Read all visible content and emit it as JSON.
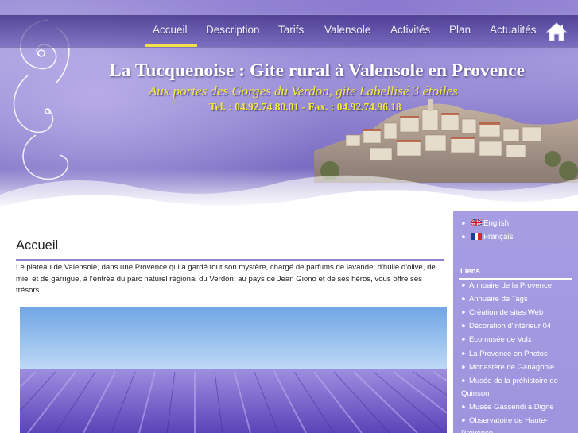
{
  "nav": {
    "items": [
      {
        "label": "Accueil",
        "active": true
      },
      {
        "label": "Description"
      },
      {
        "label": "Tarifs"
      },
      {
        "label": "Valensole"
      },
      {
        "label": "Activités"
      },
      {
        "label": "Plan"
      },
      {
        "label": "Actualités"
      }
    ],
    "home_icon": "home-icon",
    "accent_color": "#f2e04b"
  },
  "header": {
    "title": "La Tucquenoise : Gite rural à Valensole en Provence",
    "subtitle": "Aux portes des Gorges du Verdon, gite Labellisé 3 étoiles",
    "phone": "Tel. : 04.92.74.80.01 - Fax. : 04.92.74.96.18"
  },
  "main": {
    "heading": "Accueil",
    "intro": "Le plateau de Valensole, dans une Provence qui a gardé tout son mystère,  chargé de parfums de lavande, d'huile d'olive, de miel et de garrigue, à l'entrée du parc naturel régional du Verdon, au pays de Jean Giono et de ses héros, vous offre ses trésors."
  },
  "sidebar": {
    "languages": [
      {
        "label": "English",
        "flag": "uk-flag-icon"
      },
      {
        "label": "Français",
        "flag": "fr-flag-icon"
      }
    ],
    "links_title": "Liens",
    "links": [
      "Annuaire de la Provence",
      "Annuaire de Tags",
      "Création de sites Web",
      "Décoration d'intérieur 04",
      "Ecomusée de Volx",
      "La Provence en Photos",
      "Monastère de Ganagobie",
      "Musée de la préhistoire de Quinson",
      "Musée Gassendi à Digne",
      "Observatoire de Haute-Provence"
    ]
  },
  "colors": {
    "lavender": "#9e94dd",
    "title_yellow": "#f5e93a",
    "rule": "#8d84d2"
  }
}
